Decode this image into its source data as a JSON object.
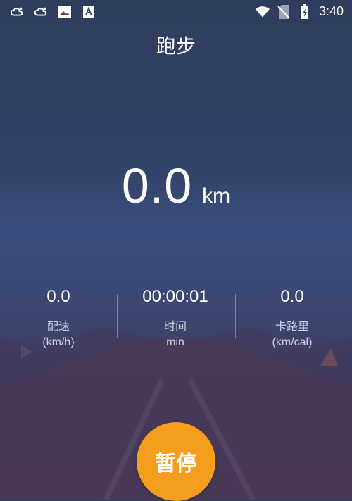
{
  "status_bar": {
    "time": "3:40",
    "left_icons": [
      "cloud-sun-icon",
      "cloud-sun-icon",
      "image-icon",
      "app-a-icon"
    ],
    "right_icons": [
      "wifi-icon",
      "no-sim-icon",
      "battery-charging-icon"
    ]
  },
  "header": {
    "title": "跑步"
  },
  "distance": {
    "value": "0.0",
    "unit": "km"
  },
  "stats": [
    {
      "value": "0.0",
      "label": "配速",
      "unit": "(km/h)"
    },
    {
      "value": "00:00:01",
      "label": "时间",
      "unit": "min"
    },
    {
      "value": "0.0",
      "label": "卡路里",
      "unit": "(km/cal)"
    }
  ],
  "pause_button": {
    "label": "暂停",
    "color": "#f59d1c"
  }
}
